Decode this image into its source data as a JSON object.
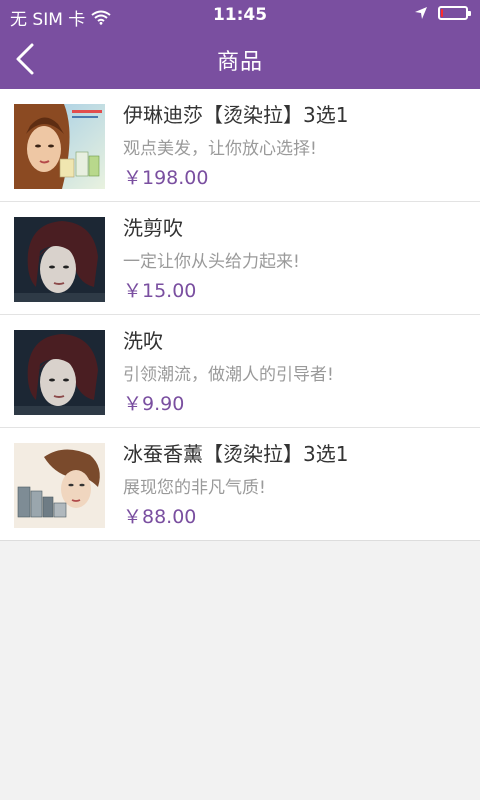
{
  "status_bar": {
    "carrier": "无 SIM 卡",
    "time": "11:45",
    "battery_level": 0.1
  },
  "nav": {
    "title": "商品",
    "back_icon": "chevron-left-icon"
  },
  "products": [
    {
      "name": "伊琳迪莎【烫染拉】3选1",
      "description": "观点美发，让你放心选择!",
      "price": "￥198.00"
    },
    {
      "name": "洗剪吹",
      "description": "一定让你从头给力起来!",
      "price": "￥15.00"
    },
    {
      "name": "洗吹",
      "description": "引领潮流，做潮人的引导者!",
      "price": "￥9.90"
    },
    {
      "name": "冰蚕香薰【烫染拉】3选1",
      "description": "展现您的非凡气质!",
      "price": "￥88.00"
    }
  ],
  "colors": {
    "header": "#7a4fa0",
    "price": "#7a4fa0",
    "background": "#f2f2f2"
  }
}
